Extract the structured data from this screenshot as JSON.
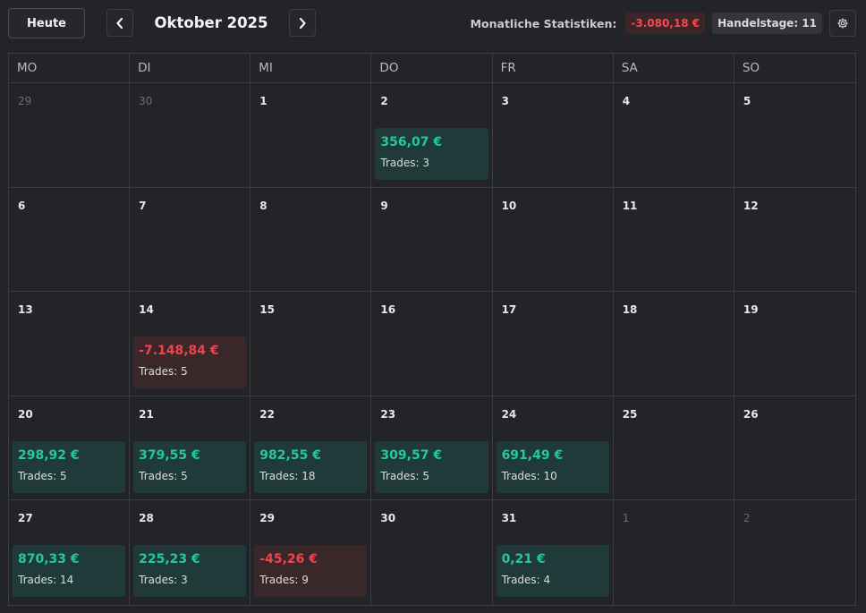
{
  "toolbar": {
    "today_label": "Heute",
    "month_title": "Oktober 2025",
    "prev_icon": "chevron-left-icon",
    "next_icon": "chevron-right-icon",
    "settings_icon": "gear-icon"
  },
  "stats": {
    "label": "Monatliche Statistiken:",
    "monthly_pnl": "-3.080,18 €",
    "trading_days": "Handelstage: 11"
  },
  "colors": {
    "positive": "#25c7a0",
    "negative": "#f2434a",
    "positive_bg": "#1f3a38",
    "negative_bg": "#3a2729"
  },
  "weekdays": [
    "MO",
    "DI",
    "MI",
    "DO",
    "FR",
    "SA",
    "SO"
  ],
  "trades_prefix": "Trades: ",
  "days": [
    {
      "day": "29",
      "outside": true
    },
    {
      "day": "30",
      "outside": true
    },
    {
      "day": "1"
    },
    {
      "day": "2",
      "pnl": "356,07 €",
      "trades": 3,
      "sign": "pos"
    },
    {
      "day": "3"
    },
    {
      "day": "4"
    },
    {
      "day": "5"
    },
    {
      "day": "6"
    },
    {
      "day": "7"
    },
    {
      "day": "8"
    },
    {
      "day": "9"
    },
    {
      "day": "10"
    },
    {
      "day": "11"
    },
    {
      "day": "12"
    },
    {
      "day": "13"
    },
    {
      "day": "14",
      "pnl": "-7.148,84 €",
      "trades": 5,
      "sign": "neg"
    },
    {
      "day": "15"
    },
    {
      "day": "16"
    },
    {
      "day": "17"
    },
    {
      "day": "18"
    },
    {
      "day": "19"
    },
    {
      "day": "20",
      "pnl": "298,92 €",
      "trades": 5,
      "sign": "pos"
    },
    {
      "day": "21",
      "pnl": "379,55 €",
      "trades": 5,
      "sign": "pos"
    },
    {
      "day": "22",
      "pnl": "982,55 €",
      "trades": 18,
      "sign": "pos"
    },
    {
      "day": "23",
      "pnl": "309,57 €",
      "trades": 5,
      "sign": "pos"
    },
    {
      "day": "24",
      "pnl": "691,49 €",
      "trades": 10,
      "sign": "pos"
    },
    {
      "day": "25"
    },
    {
      "day": "26"
    },
    {
      "day": "27",
      "pnl": "870,33 €",
      "trades": 14,
      "sign": "pos"
    },
    {
      "day": "28",
      "pnl": "225,23 €",
      "trades": 3,
      "sign": "pos"
    },
    {
      "day": "29",
      "pnl": "-45,26 €",
      "trades": 9,
      "sign": "neg"
    },
    {
      "day": "30"
    },
    {
      "day": "31",
      "pnl": "0,21 €",
      "trades": 4,
      "sign": "pos"
    },
    {
      "day": "1",
      "outside": true
    },
    {
      "day": "2",
      "outside": true
    }
  ]
}
